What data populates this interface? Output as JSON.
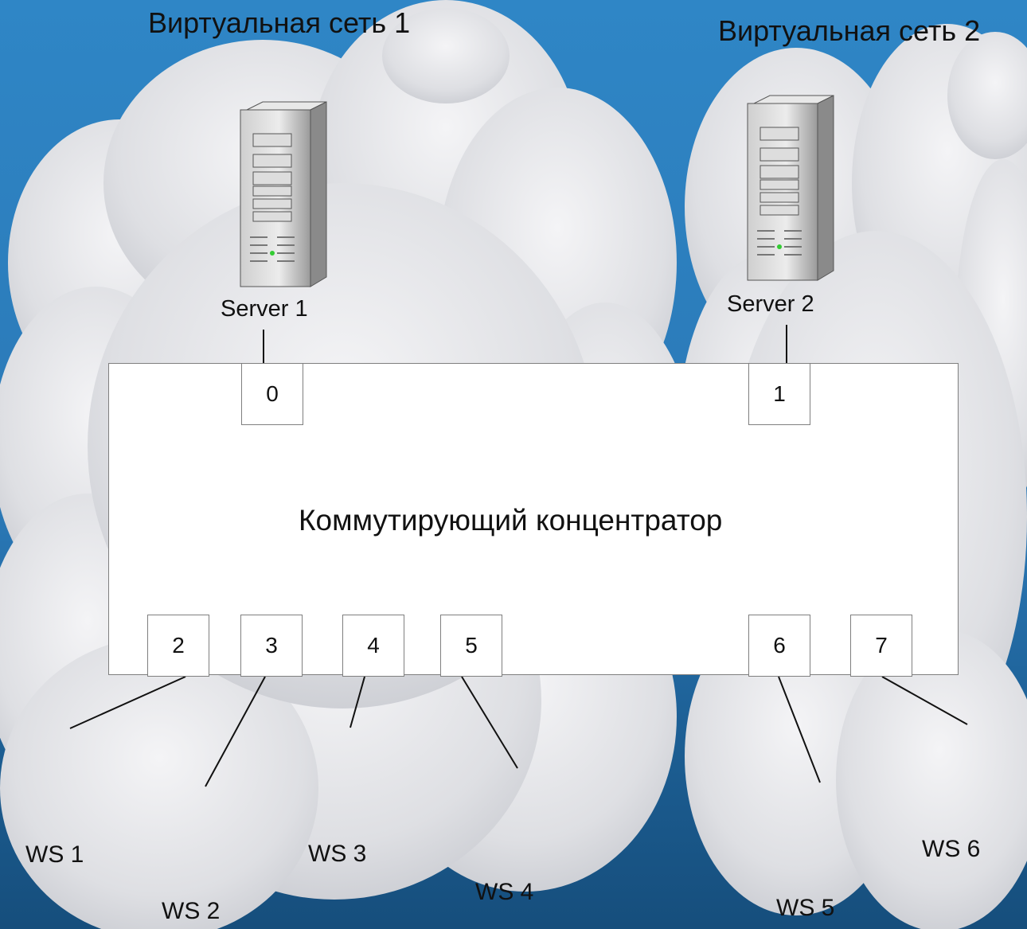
{
  "networks": {
    "vnet1_label": "Виртуальная сеть 1",
    "vnet2_label": "Виртуальная сеть 2"
  },
  "hub": {
    "label": "Коммутирующий концентратор"
  },
  "ports": [
    "0",
    "1",
    "2",
    "3",
    "4",
    "5",
    "6",
    "7"
  ],
  "servers": [
    {
      "label": "Server 1"
    },
    {
      "label": "Server 2"
    }
  ],
  "workstations": [
    {
      "label": "WS 1"
    },
    {
      "label": "WS 2"
    },
    {
      "label": "WS 3"
    },
    {
      "label": "WS 4"
    },
    {
      "label": "WS 5"
    },
    {
      "label": "WS 6"
    }
  ],
  "colors": {
    "background": "#2a78b6",
    "cloud": "#e6e7ea",
    "hub_fill": "#ffffff",
    "screen": "#9aa2f0"
  }
}
